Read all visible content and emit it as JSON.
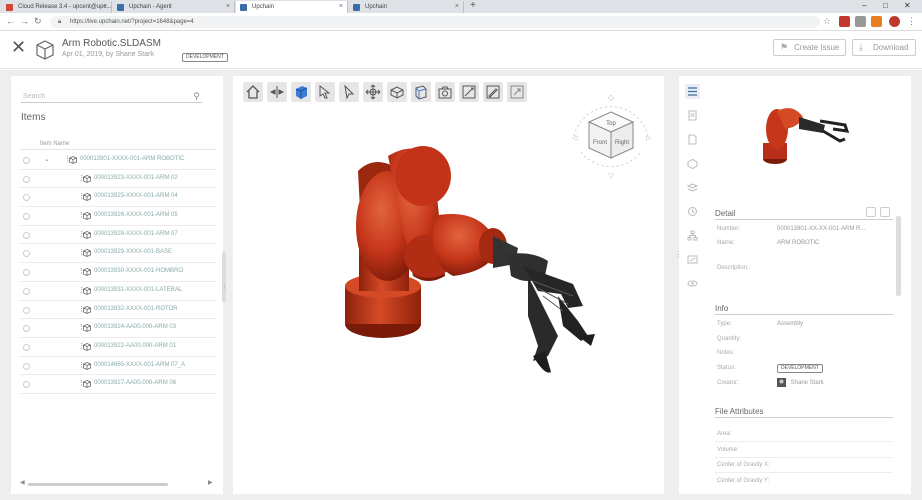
{
  "browser": {
    "tabs": [
      {
        "title": "Cloud Release 3.4 - upcent@upc...",
        "favicon_color": "#d44638",
        "active": false
      },
      {
        "title": "Upchain - Agent",
        "favicon_color": "#3b6ea5",
        "active": false
      },
      {
        "title": "Upchain",
        "favicon_color": "#3b6ea5",
        "active": true
      },
      {
        "title": "Upchain",
        "favicon_color": "#3b6ea5",
        "active": false
      }
    ],
    "url": "https://live.upchain.net/?project=1648&page=4",
    "new_tab": "+",
    "window_controls": [
      "–",
      "□",
      "✕"
    ]
  },
  "header": {
    "title": "Arm Robotic.SLDASM",
    "subtitle": "Apr 01, 2019, by Shane Stark",
    "badge": "DEVELOPMENT",
    "create_issue": "Create Issue",
    "download": "Download"
  },
  "left_panel": {
    "search_placeholder": "Search",
    "title": "Items",
    "column_header": "Item Name",
    "rows": [
      {
        "label": "000013901-XXXX-001-ARM ROBOTIC",
        "level": 0
      },
      {
        "label": "000013923-XXXX-001-ARM 02",
        "level": 1
      },
      {
        "label": "000013925-XXXX-001-ARM 04",
        "level": 1
      },
      {
        "label": "000013926-XXXX-001-ARM 05",
        "level": 1
      },
      {
        "label": "000013928-XXXX-001-ARM 07",
        "level": 1
      },
      {
        "label": "000013929-XXXX-001-BASE",
        "level": 1
      },
      {
        "label": "000013930-XXXX-001-HOMBRO",
        "level": 1
      },
      {
        "label": "000013931-XXXX-001-LATERAL",
        "level": 1
      },
      {
        "label": "000013932-XXXX-001-ROTOR",
        "level": 1
      },
      {
        "label": "000013924-AA00.000-ARM 03",
        "level": 1
      },
      {
        "label": "000013922-AA00.000-ARM 01",
        "level": 1
      },
      {
        "label": "000014665-XXXX-001-ARM 07_A",
        "level": 1
      },
      {
        "label": "000013927-AA00.000-ARM 06",
        "level": 1
      }
    ]
  },
  "viewer": {
    "tools": [
      "home-icon",
      "explode-icon",
      "shaded-cube-icon",
      "select-arrow-icon",
      "pointer-icon",
      "pan-icon",
      "measure-icon",
      "section-icon",
      "camera-icon",
      "markup-icon",
      "markup-edit-icon",
      "export-icon"
    ],
    "navcube": {
      "top": "Top",
      "front": "Front",
      "right": "Right"
    },
    "model_colors": {
      "arm": "#c6361a",
      "gripper": "#2a2a2a"
    }
  },
  "right_panel": {
    "detail_title": "Detail",
    "detail_fields": [
      {
        "label": "Number:",
        "value": "000013901-XX-XX-001-ARM R..."
      },
      {
        "label": "Name:",
        "value": "ARM ROBOTIC"
      },
      {
        "label": "Description:",
        "value": ""
      }
    ],
    "info_title": "Info",
    "info_fields": [
      {
        "label": "Type:",
        "value": "Assembly"
      },
      {
        "label": "Quantity:",
        "value": ""
      },
      {
        "label": "Notes:",
        "value": ""
      },
      {
        "label": "Status:",
        "value": "DEVELOPMENT"
      },
      {
        "label": "Creator:",
        "value": "Shane Stark"
      }
    ],
    "attributes_title": "File Attributes",
    "attribute_fields": [
      "Area:",
      "Volume:",
      "Center of Gravity X:",
      "Center of Gravity Y:"
    ]
  }
}
